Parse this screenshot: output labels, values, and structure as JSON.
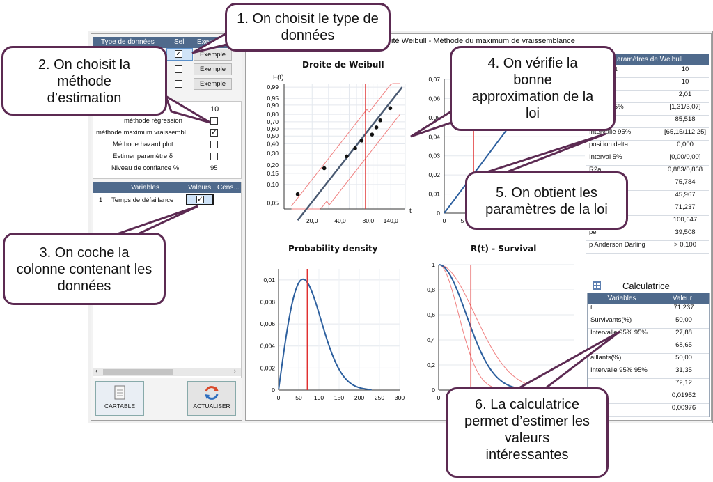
{
  "window": {
    "title": "ité Weibull - Méthode du maximum de vraissemblance"
  },
  "data_types_table": {
    "headers": [
      "Type de données",
      "Sel",
      "Exem"
    ],
    "rows": [
      {
        "checked": true,
        "button": "Exemple"
      },
      {
        "checked": false,
        "button": "Exemple"
      },
      {
        "checked": false,
        "button": "Exemple"
      }
    ]
  },
  "options": {
    "rows": [
      {
        "label": "",
        "value": "10"
      },
      {
        "label": "méthode régression",
        "checked": false
      },
      {
        "label": "méthode maximum vraissembl..",
        "checked": true
      },
      {
        "label": "Méthode hazard plot",
        "checked": false
      },
      {
        "label": "Estimer paramètre δ",
        "checked": false
      },
      {
        "label": "Niveau de confiance %",
        "value": "95"
      }
    ]
  },
  "variables_table": {
    "headers": [
      "Variables",
      "Valeurs",
      "Cens..."
    ],
    "rows": [
      {
        "index": "1",
        "name": "Temps de défaillance",
        "checked": true
      }
    ]
  },
  "buttons": {
    "cartable": "CARTABLE",
    "actualiser": "ACTUALISER"
  },
  "plots": {
    "weibull": {
      "title": "Droite de Weibull",
      "ylabel": "F(t)",
      "xlabel": "t",
      "yticks": [
        "0,99",
        "0,95",
        "0,90",
        "0,80",
        "0,70",
        "0,60",
        "0,50",
        "0,40",
        "0,30",
        "0,20",
        "0,15",
        "0,10",
        "0,05"
      ],
      "xticks": [
        "20,0",
        "40,0",
        "80,0",
        "140,0"
      ]
    },
    "hazard": {
      "yticks": [
        "0,07",
        "0,06",
        "0,05",
        "0,04",
        "0,03",
        "0,02",
        "0,01",
        "0"
      ],
      "xticks": [
        "0",
        "5"
      ]
    },
    "density": {
      "title": "Probability density",
      "yticks": [
        "0,01",
        "0,008",
        "0,006",
        "0,004",
        "0,002",
        "0"
      ],
      "xticks": [
        "0",
        "50",
        "100",
        "150",
        "200",
        "250",
        "300"
      ]
    },
    "survival": {
      "title": "R(t) - Survival",
      "yticks": [
        "1",
        "0,8",
        "0,6",
        "0,4",
        "0,2",
        "0"
      ],
      "xticks": [
        "0"
      ]
    }
  },
  "chart_data": [
    {
      "type": "scatter",
      "title": "Droite de Weibull",
      "ylabel": "F(t)",
      "xlabel": "t",
      "x_scale": "log",
      "y_scale": "weibull",
      "points": [
        [
          14,
          0.07
        ],
        [
          27,
          0.18
        ],
        [
          47,
          0.27
        ],
        [
          58,
          0.35
        ],
        [
          68,
          0.44
        ],
        [
          88,
          0.52
        ],
        [
          98,
          0.62
        ],
        [
          108,
          0.72
        ],
        [
          138,
          0.87
        ]
      ],
      "fit_beta": 2.01,
      "fit_theta": 85.518,
      "vertical_line_x": 75
    },
    {
      "type": "line",
      "title": "Probability density",
      "xlim": [
        0,
        300
      ],
      "ylim": [
        0,
        0.011
      ],
      "beta": 2.01,
      "theta": 85.518,
      "vertical_line_x": 71.237
    },
    {
      "type": "line",
      "title": "R(t) - Survival",
      "ylim": [
        0,
        1
      ],
      "vertical_line_x": 71.237
    }
  ],
  "params": {
    "header": "aramètres de Weibull",
    "rows": [
      {
        "k": "its en test",
        "v": "10"
      },
      {
        "k": "aillances",
        "v": "10"
      },
      {
        "k": "me beta",
        "v": "2,01"
      },
      {
        "k": "ervalle 95%",
        "v": "[1,31/3,07]"
      },
      {
        "k": "elle teta",
        "v": "85,518"
      },
      {
        "k": "Intervalle 95%",
        "v": "[65,15/112,25]"
      },
      {
        "k": "position delta",
        "v": "0,000"
      },
      {
        "k": "Interval   5%",
        "v": "[0,00/0,00]"
      },
      {
        "k": "R2aj",
        "v": "0,883/0,868"
      },
      {
        "k": "Moyenne",
        "v": "75,784"
      },
      {
        "k": "artile",
        "v": "45,967"
      },
      {
        "k": "e",
        "v": "71,237"
      },
      {
        "k": "uartile",
        "v": "100,647"
      },
      {
        "k": "pe",
        "v": "39,508"
      },
      {
        "k": "p Anderson Darling",
        "v": "> 0,100"
      }
    ]
  },
  "calc": {
    "title": "Calculatrice",
    "headers": [
      "Variables",
      "Valeur"
    ],
    "rows": [
      {
        "k": "t",
        "v": "71,237"
      },
      {
        "k": "Survivants(%)",
        "v": "50,00"
      },
      {
        "k": "Intervalle 95% 95%",
        "v": "27,88"
      },
      {
        "k": "",
        "v": "68,65"
      },
      {
        "k": "aillants(%)",
        "v": "50,00"
      },
      {
        "k": "Intervalle 95% 95%",
        "v": "31,35"
      },
      {
        "k": "",
        "v": "72,12"
      },
      {
        "k": "a",
        "v": "0,01952"
      },
      {
        "k": "",
        "v": "0,00976"
      }
    ]
  },
  "callouts": {
    "c1": "1. On choisit le type de données",
    "c2": "2. On choisit la méthode d’estimation",
    "c3": "3. On coche la colonne contenant les données",
    "c4": "4. On vérifie la bonne approximation de la loi",
    "c5": "5. On obtient les paramètres de la loi",
    "c6": "6. La calculatrice permet d’estimer les valeurs intéressantes"
  },
  "colors": {
    "header": "#4f6a8c",
    "curve": "#2c5f9e",
    "conf": "#f08080",
    "redline": "#e03030",
    "callout_border": "#5c2a52"
  }
}
